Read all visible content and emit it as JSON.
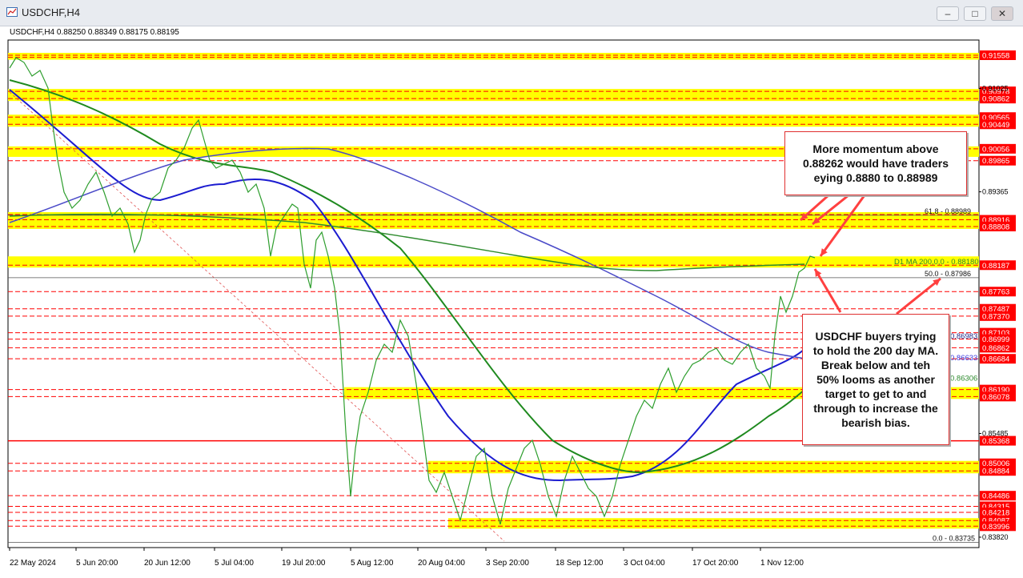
{
  "window": {
    "title": "USDCHF,H4",
    "buttons": [
      "minimize",
      "maximize",
      "close"
    ]
  },
  "chart_info": "USDCHF,H4  0.88250 0.88349 0.88175 0.88195",
  "chart_data": {
    "type": "line",
    "symbol": "USDCHF",
    "timeframe": "H4",
    "ohlc": {
      "open": 0.8825,
      "high": 0.88349,
      "low": 0.88175,
      "close": 0.88195
    },
    "ylim": [
      0.837,
      0.917
    ],
    "x_ticks": [
      "22 May 2024",
      "5 Jun 20:00",
      "20 Jun 12:00",
      "5 Jul 04:00",
      "19 Jul 20:00",
      "5 Aug 12:00",
      "20 Aug 04:00",
      "3 Sep 20:00",
      "18 Sep 12:00",
      "3 Oct 04:00",
      "17 Oct 20:00",
      "1 Nov 12:00"
    ],
    "y_ticks": [
      0.91025,
      0.89365,
      0.85485,
      0.8382
    ],
    "price_levels": [
      {
        "price": 0.91558,
        "kind": "band",
        "color": "#ff0000"
      },
      {
        "price": 0.91525,
        "kind": "band"
      },
      {
        "price": 0.90978,
        "kind": "band",
        "color": "#ff0000"
      },
      {
        "price": 0.90862,
        "kind": "band",
        "color": "#ff0000"
      },
      {
        "price": 0.90565,
        "kind": "band",
        "color": "#ff0000"
      },
      {
        "price": 0.90449,
        "kind": "band",
        "color": "#ff0000"
      },
      {
        "price": 0.90056,
        "kind": "band",
        "color": "#ff0000"
      },
      {
        "price": 0.89865,
        "kind": "dash",
        "color": "#ff0000"
      },
      {
        "price": 0.89,
        "kind": "band",
        "color": "#ff0000"
      },
      {
        "price": 0.88916,
        "kind": "band",
        "color": "#ff0000"
      },
      {
        "price": 0.88808,
        "kind": "band",
        "color": "#ff0000"
      },
      {
        "price": 0.88187,
        "kind": "band",
        "color": "#ff0000"
      },
      {
        "price": 0.87763,
        "kind": "dash",
        "color": "#ff0000"
      },
      {
        "price": 0.87487,
        "kind": "dash",
        "color": "#ff0000"
      },
      {
        "price": 0.8737,
        "kind": "dash",
        "color": "#ff0000"
      },
      {
        "price": 0.87103,
        "kind": "dash",
        "color": "#ff0000"
      },
      {
        "price": 0.86999,
        "kind": "dash",
        "color": "#ff0000"
      },
      {
        "price": 0.86862,
        "kind": "dash",
        "color": "#ff0000"
      },
      {
        "price": 0.86684,
        "kind": "dash",
        "color": "#ff0000"
      },
      {
        "price": 0.8619,
        "kind": "band",
        "color": "#ff0000"
      },
      {
        "price": 0.86078,
        "kind": "band",
        "color": "#ff0000"
      },
      {
        "price": 0.85368,
        "kind": "solid",
        "color": "#ff0000"
      },
      {
        "price": 0.85006,
        "kind": "band",
        "color": "#ff0000"
      },
      {
        "price": 0.84884,
        "kind": "band",
        "color": "#ff0000"
      },
      {
        "price": 0.84486,
        "kind": "dash",
        "color": "#ff0000"
      },
      {
        "price": 0.84315,
        "kind": "dash",
        "color": "#ff0000"
      },
      {
        "price": 0.84218,
        "kind": "dash",
        "color": "#ff0000"
      },
      {
        "price": 0.84087,
        "kind": "band",
        "color": "#ff0000"
      },
      {
        "price": 0.83996,
        "kind": "band",
        "color": "#ff0000"
      }
    ],
    "price_labels": [
      {
        "text": "0.91558",
        "price": 0.91558,
        "color": "#ff0000"
      },
      {
        "text": "0.90978",
        "price": 0.90978,
        "color": "#ff0000"
      },
      {
        "text": "0.90862",
        "price": 0.90862,
        "color": "#ff0000"
      },
      {
        "text": "0.90565",
        "price": 0.90565,
        "color": "#ff0000"
      },
      {
        "text": "0.90449",
        "price": 0.90449,
        "color": "#ff0000"
      },
      {
        "text": "0.90056",
        "price": 0.90056,
        "color": "#ff0000"
      },
      {
        "text": "0.89865",
        "price": 0.89865,
        "color": "#ff0000"
      },
      {
        "text": "0.88916",
        "price": 0.88916,
        "color": "#ff0000"
      },
      {
        "text": "0.88808",
        "price": 0.88808,
        "color": "#ff0000"
      },
      {
        "text": "0.88187",
        "price": 0.88187,
        "color": "#ff0000"
      },
      {
        "text": "0.87763",
        "price": 0.87763,
        "color": "#ff0000"
      },
      {
        "text": "0.87487",
        "price": 0.87487,
        "color": "#ff0000"
      },
      {
        "text": "0.87370",
        "price": 0.8737,
        "color": "#ff0000"
      },
      {
        "text": "0.87103",
        "price": 0.87103,
        "color": "#ff0000"
      },
      {
        "text": "0.86999",
        "price": 0.86999,
        "color": "#ff0000"
      },
      {
        "text": "0.86862",
        "price": 0.86862,
        "color": "#ff0000"
      },
      {
        "text": "0.86684",
        "price": 0.86684,
        "color": "#ff0000"
      },
      {
        "text": "0.86190",
        "price": 0.8619,
        "color": "#ff0000"
      },
      {
        "text": "0.86078",
        "price": 0.86078,
        "color": "#ff0000"
      },
      {
        "text": "0.85368",
        "price": 0.85368,
        "color": "#ff0000"
      },
      {
        "text": "0.85006",
        "price": 0.85006,
        "color": "#ff0000"
      },
      {
        "text": "0.84884",
        "price": 0.84884,
        "color": "#ff0000"
      },
      {
        "text": "0.84486",
        "price": 0.84486,
        "color": "#ff0000"
      },
      {
        "text": "0.84315",
        "price": 0.84315,
        "color": "#ff0000"
      },
      {
        "text": "0.84218",
        "price": 0.84218,
        "color": "#ff0000"
      },
      {
        "text": "0.84087",
        "price": 0.84087,
        "color": "#ff0000"
      },
      {
        "text": "0.83996",
        "price": 0.83996,
        "color": "#ff0000"
      },
      {
        "text": "0.91025",
        "price": 0.91025,
        "color": "#ffffff"
      },
      {
        "text": "0.89365",
        "price": 0.89365,
        "color": "#ffffff"
      },
      {
        "text": "0.85485",
        "price": 0.85485,
        "color": "#ffffff"
      },
      {
        "text": "0.83820",
        "price": 0.8382,
        "color": "#ffffff"
      }
    ],
    "fib_levels": [
      {
        "label": "61.8 - 0.88989",
        "price": 0.88989
      },
      {
        "label": "50.0 - 0.87986",
        "price": 0.87986
      },
      {
        "label": "0.0 - 0.83735",
        "price": 0.83735
      }
    ],
    "ma_labels": [
      {
        "label": "D1 MA 200,0,0 - 0.88180",
        "price": 0.8818,
        "color": "#2e8b2e"
      },
      {
        "label": "0.86983",
        "price": 0.86983,
        "color": "#1e2a8a"
      },
      {
        "label": "0.86633",
        "price": 0.86633,
        "color": "#3a3ae0"
      },
      {
        "label": "0.86306",
        "price": 0.86306,
        "color": "#2e8b2e"
      }
    ],
    "series": [
      {
        "name": "price",
        "color": "#2e9e2e"
      },
      {
        "color": "#1c1cd0"
      },
      {
        "color": "#1f8a1f"
      },
      {
        "color": "#4a4ac8"
      },
      {
        "color": "#2e8b2e"
      }
    ]
  },
  "annotations": {
    "top_note": [
      "More momentum above",
      "0.88262 would have traders",
      "eying 0.8880 to 0.88989"
    ],
    "bottom_note": [
      "USDCHF buyers trying",
      "to hold the 200 day MA.",
      "Break below and teh",
      "50% looms as another",
      "target to get to and",
      "through to increase the",
      "bearish bias."
    ]
  }
}
